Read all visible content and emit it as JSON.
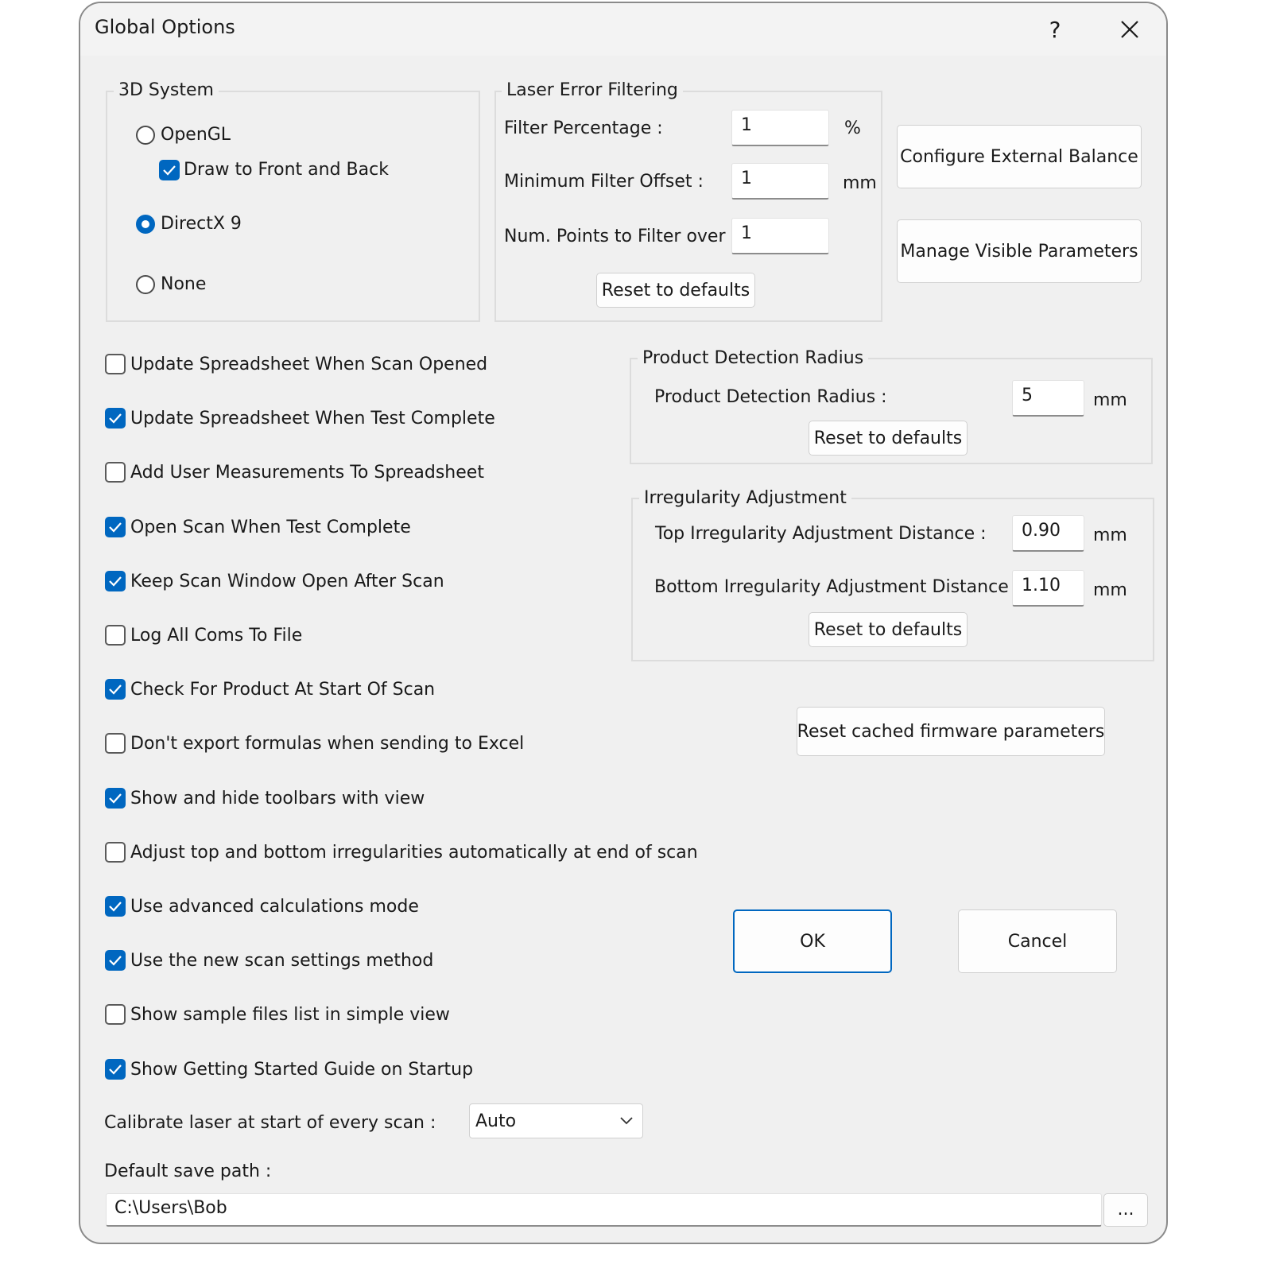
{
  "window": {
    "title": "Global Options",
    "help_glyph": "?",
    "close_glyph": "✕"
  },
  "system3d": {
    "title": "3D System",
    "opengl_label": "OpenGL",
    "opengl_selected": false,
    "draw_front_back_label": "Draw to Front and Back",
    "draw_front_back_checked": true,
    "directx_label": "DirectX 9",
    "directx_selected": true,
    "none_label": "None",
    "none_selected": false
  },
  "laser_filter": {
    "title": "Laser Error Filtering",
    "filter_percentage_label": "Filter Percentage :",
    "filter_percentage_value": "1",
    "filter_percentage_unit": "%",
    "min_offset_label": "Minimum Filter Offset :",
    "min_offset_value": "1",
    "min_offset_unit": "mm",
    "num_points_label": "Num. Points to Filter over :",
    "num_points_value": "1",
    "reset_label": "Reset to defaults"
  },
  "side_buttons": {
    "configure_balance": "Configure External Balance",
    "manage_params": "Manage Visible Parameters"
  },
  "options": [
    {
      "label": "Update Spreadsheet When Scan Opened",
      "checked": false
    },
    {
      "label": "Update Spreadsheet When Test Complete",
      "checked": true
    },
    {
      "label": "Add User Measurements To Spreadsheet",
      "checked": false
    },
    {
      "label": "Open Scan When Test Complete",
      "checked": true
    },
    {
      "label": "Keep Scan Window Open After Scan",
      "checked": true
    },
    {
      "label": "Log All Coms To File",
      "checked": false
    },
    {
      "label": "Check For Product At Start Of Scan",
      "checked": true
    },
    {
      "label": "Don't export formulas when sending to Excel",
      "checked": false
    },
    {
      "label": "Show and hide toolbars with view",
      "checked": true
    },
    {
      "label": "Adjust top and bottom irregularities automatically at end of scan",
      "checked": false
    },
    {
      "label": "Use advanced calculations mode",
      "checked": true
    },
    {
      "label": "Use the new scan settings method",
      "checked": true
    },
    {
      "label": "Show sample files list in simple view",
      "checked": false
    },
    {
      "label": "Show Getting Started Guide on Startup",
      "checked": true
    }
  ],
  "product_detection": {
    "title": "Product Detection Radius",
    "radius_label": "Product Detection Radius :",
    "radius_value": "5",
    "radius_unit": "mm",
    "reset_label": "Reset to defaults"
  },
  "irregularity": {
    "title": "Irregularity Adjustment",
    "top_label": "Top Irregularity Adjustment Distance :",
    "top_value": "0.90",
    "top_unit": "mm",
    "bottom_label": "Bottom Irregularity Adjustment Distance :",
    "bottom_value": "1.10",
    "bottom_unit": "mm",
    "reset_label": "Reset to defaults"
  },
  "firmware": {
    "reset_label": "Reset cached firmware parameters"
  },
  "dialog_buttons": {
    "ok": "OK",
    "cancel": "Cancel"
  },
  "calibrate": {
    "label": "Calibrate laser at start of every scan :",
    "value": "Auto"
  },
  "save_path": {
    "label": "Default save path :",
    "value": "C:\\Users\\Bob",
    "browse": "..."
  },
  "colors": {
    "accent": "#0067c0",
    "dialog_bg": "#f0f0f0"
  }
}
